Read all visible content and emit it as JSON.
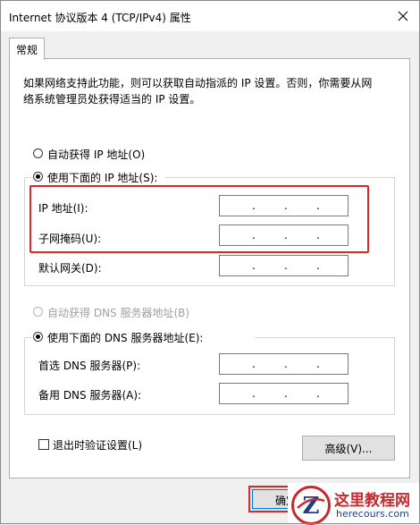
{
  "window": {
    "title": "Internet 协议版本 4 (TCP/IPv4) 属性"
  },
  "tab": {
    "label": "常规"
  },
  "description": "如果网络支持此功能，则可以获取自动指派的 IP 设置。否则，你需要从网\n络系统管理员处获得适当的 IP 设置。",
  "ip_section": {
    "auto_label": "自动获得 IP 地址(O)",
    "manual_label": "使用下面的 IP 地址(S):",
    "selected": "manual",
    "fields": [
      {
        "label": "IP 地址(I):",
        "value": ". . ."
      },
      {
        "label": "子网掩码(U):",
        "value": ". . ."
      },
      {
        "label": "默认网关(D):",
        "value": ". . ."
      }
    ]
  },
  "dns_section": {
    "auto_label": "自动获得 DNS 服务器地址(B)",
    "manual_label": "使用下面的 DNS 服务器地址(E):",
    "selected": "manual",
    "fields": [
      {
        "label": "首选 DNS 服务器(P):",
        "value": ". . ."
      },
      {
        "label": "备用 DNS 服务器(A):",
        "value": ". . ."
      }
    ]
  },
  "validate_checkbox": {
    "label": "退出时验证设置(L)",
    "checked": false
  },
  "buttons": {
    "advanced": "高级(V)...",
    "ok": "确定"
  },
  "watermark": {
    "name": "这里教程网",
    "url": "herecours.com",
    "logo_letter": "Z"
  },
  "colors": {
    "highlight": "#d42a2a",
    "watermark_red": "#c8282d",
    "watermark_blue": "#1f3e8a"
  }
}
